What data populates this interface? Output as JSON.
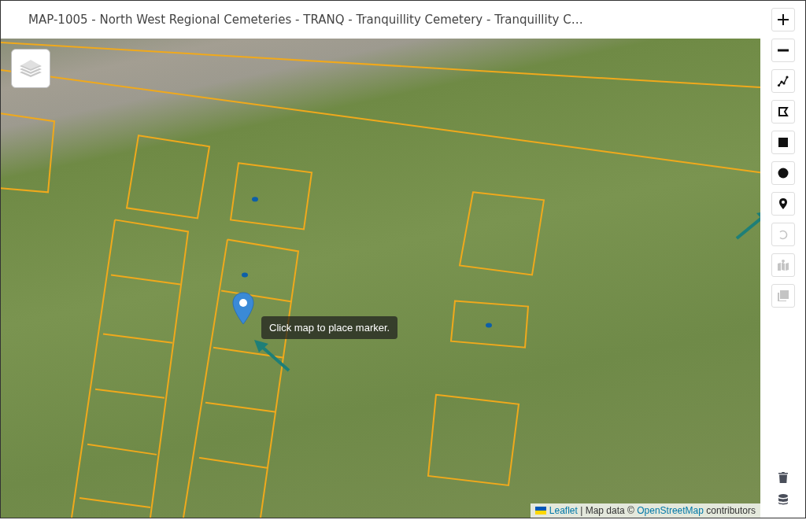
{
  "header": {
    "title": "MAP-1005 - North West Regional Cemeteries - TRANQ - Tranquillity Cemetery - Tranquillity C…"
  },
  "toolbar": {
    "tools": [
      {
        "kind": "zoom-in",
        "disabled": false
      },
      {
        "kind": "zoom-out",
        "disabled": false
      },
      {
        "kind": "polyline",
        "disabled": false
      },
      {
        "kind": "polygon",
        "disabled": false
      },
      {
        "kind": "rectangle",
        "disabled": false
      },
      {
        "kind": "circle",
        "disabled": false
      },
      {
        "kind": "marker",
        "disabled": false
      },
      {
        "kind": "undo",
        "disabled": true
      },
      {
        "kind": "import-map",
        "disabled": true
      },
      {
        "kind": "copy",
        "disabled": true
      }
    ],
    "bottom_tools": [
      {
        "kind": "trash",
        "disabled": false
      },
      {
        "kind": "database",
        "disabled": false
      }
    ]
  },
  "map": {
    "tooltip": "Click map to place marker.",
    "attribution": [
      {
        "kind": "link",
        "text": "Leaflet"
      },
      {
        "kind": "text",
        "text": "| Map data ©"
      },
      {
        "kind": "link",
        "text": "OpenStreetMap"
      },
      {
        "kind": "text",
        "text": "contributors"
      }
    ]
  }
}
